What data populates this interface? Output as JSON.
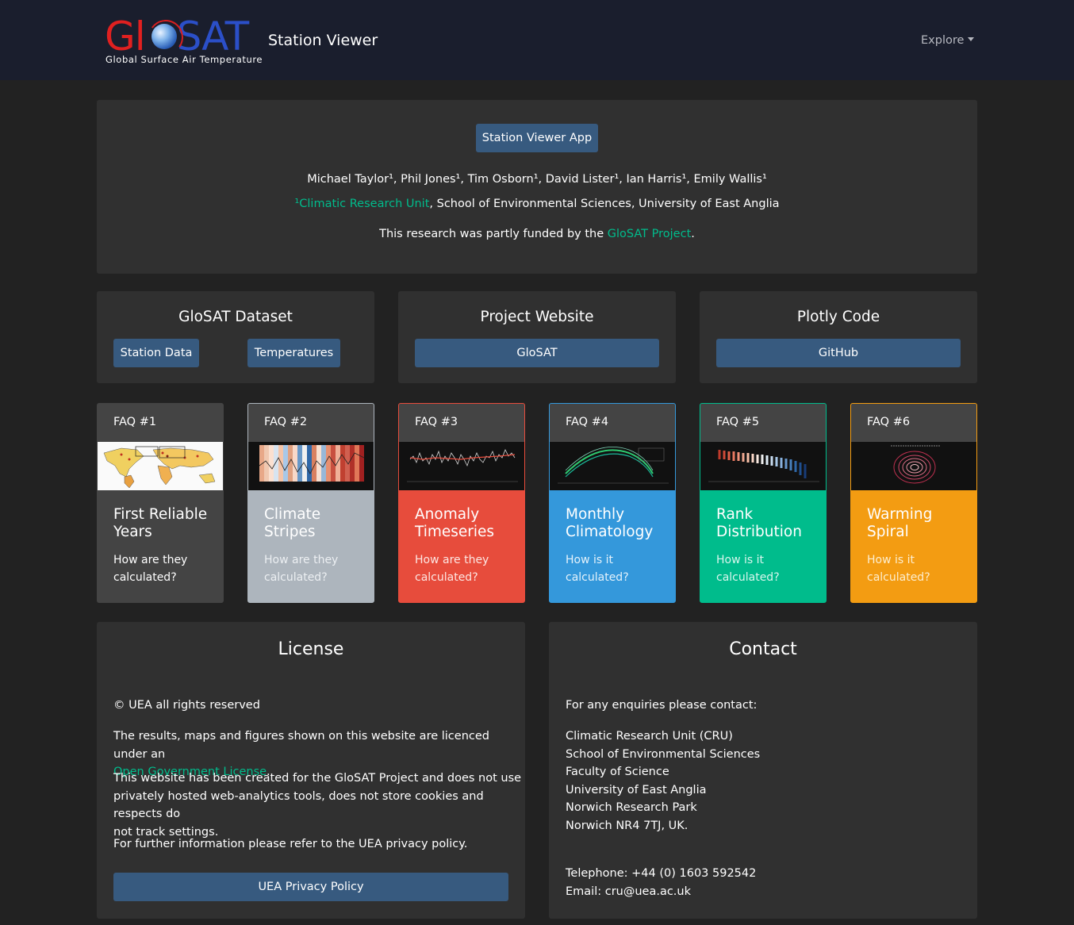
{
  "navbar": {
    "logo_main_left": "Gl",
    "logo_main_right": "SAT",
    "logo_subtitle": "Global Surface Air Temperature",
    "title": "Station Viewer",
    "explore": "Explore"
  },
  "hero": {
    "app_button": "Station Viewer App",
    "authors": "Michael Taylor¹, Phil Jones¹, Tim Osborn¹, David Lister¹, Ian Harris¹, Emily Wallis¹",
    "affiliation_link": "¹Climatic Research Unit",
    "affiliation_rest": ", School of Environmental Sciences, University of East Anglia",
    "funding_pre": "This research was partly funded by the ",
    "funding_link": "GloSAT Project",
    "funding_post": "."
  },
  "links": {
    "dataset": {
      "title": "GloSAT Dataset",
      "btn1": "Station Data",
      "btn2": "Temperatures"
    },
    "website": {
      "title": "Project Website",
      "btn": "GloSAT"
    },
    "code": {
      "title": "Plotly Code",
      "btn": "GitHub"
    }
  },
  "faqs": [
    {
      "label": "FAQ #1",
      "title_line1": "First Reliable",
      "title_line2": "Years",
      "sub_line1": "How are they",
      "sub_line2": "calculated?",
      "color": "#444444"
    },
    {
      "label": "FAQ #2",
      "title_line1": "Climate",
      "title_line2": "Stripes",
      "sub_line1": "How are they",
      "sub_line2": "calculated?",
      "color": "#adb5bd"
    },
    {
      "label": "FAQ #3",
      "title_line1": "Anomaly",
      "title_line2": "Timeseries",
      "sub_line1": "How are they",
      "sub_line2": "calculated?",
      "color": "#e74c3c"
    },
    {
      "label": "FAQ #4",
      "title_line1": "Monthly",
      "title_line2": "Climatology",
      "sub_line1": "How is it",
      "sub_line2": "calculated?",
      "color": "#3498db"
    },
    {
      "label": "FAQ #5",
      "title_line1": "Rank",
      "title_line2": "Distribution",
      "sub_line1": "How is it",
      "sub_line2": "calculated?",
      "color": "#00bc8c"
    },
    {
      "label": "FAQ #6",
      "title_line1": "Warming",
      "title_line2": "Spiral",
      "sub_line1": "How is it",
      "sub_line2": "calculated?",
      "color": "#f39c12"
    }
  ],
  "license": {
    "title": "License",
    "copyright": "© UEA all rights reserved",
    "p1_line1": "The results, maps and figures shown on this website are licenced under an",
    "p1_link": "Open Government License",
    "p1_end": ".",
    "p2_line1": "This website has been created for the GloSAT Project and does not use",
    "p2_line2": "privately hosted web-analytics tools, does not store cookies and respects do",
    "p2_line3": "not track settings.",
    "p3": "For further information please refer to the UEA privacy policy.",
    "button": "UEA Privacy Policy"
  },
  "contact": {
    "title": "Contact",
    "intro": "For any enquiries please contact:",
    "address": [
      "Climatic Research Unit (CRU)",
      "School of Environmental Sciences",
      "Faculty of Science",
      "University of East Anglia",
      "Norwich Research Park",
      "Norwich NR4 7TJ, UK."
    ],
    "telephone": "Telephone: +44 (0) 1603 592542",
    "email": "Email: cru@uea.ac.uk"
  }
}
